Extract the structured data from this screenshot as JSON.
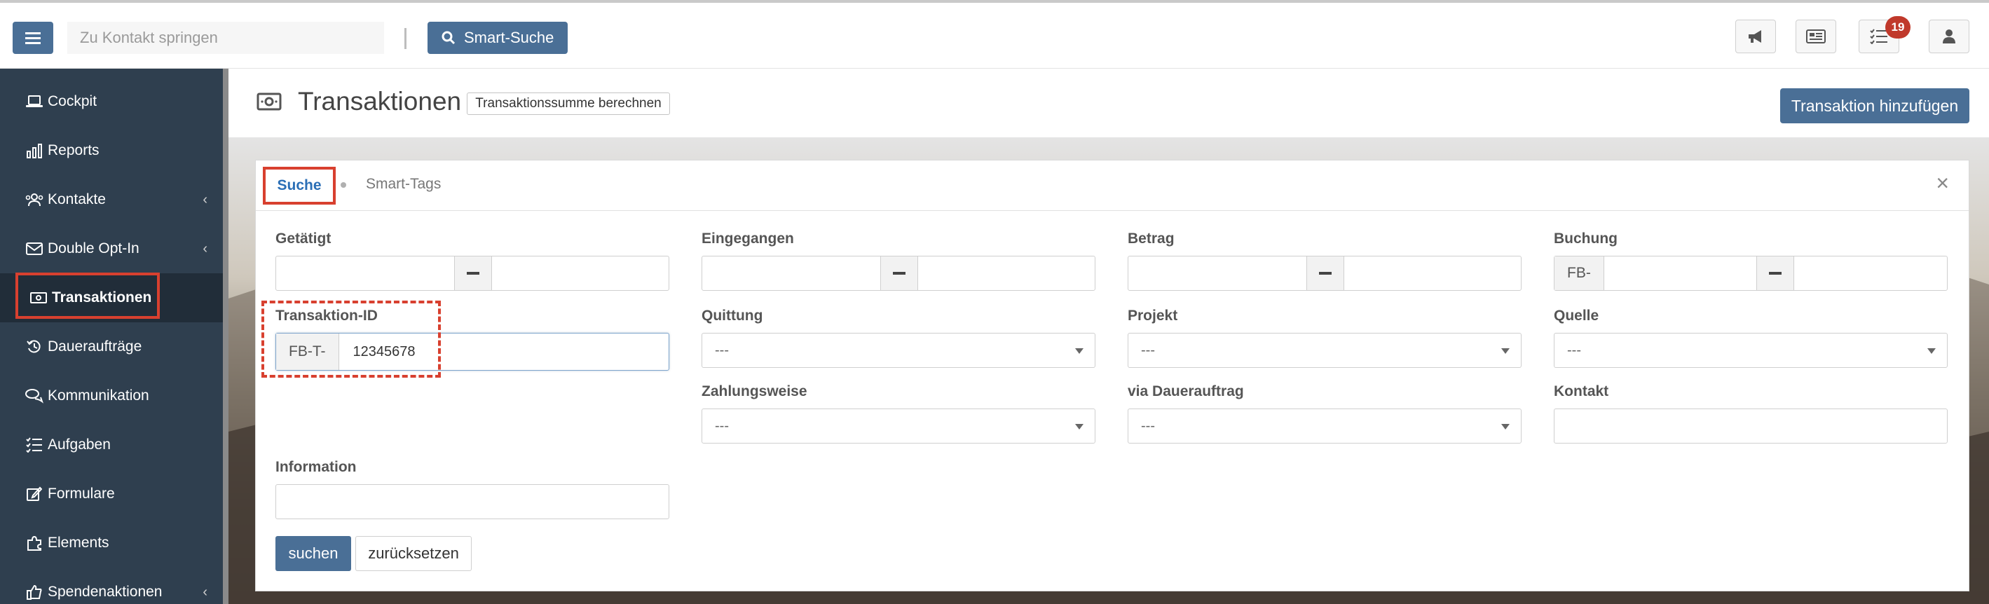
{
  "topbar": {
    "search_placeholder": "Zu Kontakt springen",
    "smart_search_label": "Smart-Suche",
    "tasks_badge": "19"
  },
  "sidebar": {
    "items": [
      {
        "label": "Cockpit",
        "icon": "laptop-icon"
      },
      {
        "label": "Reports",
        "icon": "chart-icon"
      },
      {
        "label": "Kontakte",
        "icon": "users-icon",
        "has_children": true
      },
      {
        "label": "Double Opt-In",
        "icon": "envelope-icon",
        "has_children": true
      },
      {
        "label": "Transaktionen",
        "icon": "money-icon",
        "active": true
      },
      {
        "label": "Daueraufträge",
        "icon": "history-icon"
      },
      {
        "label": "Kommunikation",
        "icon": "chat-icon"
      },
      {
        "label": "Aufgaben",
        "icon": "tasks-icon"
      },
      {
        "label": "Formulare",
        "icon": "edit-icon"
      },
      {
        "label": "Elements",
        "icon": "puzzle-icon"
      },
      {
        "label": "Spendenaktionen",
        "icon": "thumbs-up-icon",
        "has_children": true
      }
    ]
  },
  "header": {
    "title": "Transaktionen",
    "calc_button": "Transaktionssumme berechnen",
    "add_button": "Transaktion hinzufügen"
  },
  "panel": {
    "tabs": [
      {
        "label": "Suche",
        "active": true
      },
      {
        "label": "Smart-Tags",
        "active": false
      }
    ],
    "close": "×",
    "fields": {
      "getaetigt": "Getätigt",
      "eingegangen": "Eingegangen",
      "betrag": "Betrag",
      "buchung": "Buchung",
      "buchung_prefix": "FB-",
      "transaktion_id": "Transaktion-ID",
      "transaktion_id_prefix": "FB-T-",
      "transaktion_id_value": "12345678",
      "quittung": "Quittung",
      "quittung_value": "---",
      "projekt": "Projekt",
      "projekt_value": "---",
      "quelle": "Quelle",
      "quelle_value": "---",
      "zahlungsweise": "Zahlungsweise",
      "zahlungsweise_value": "---",
      "via_dauerauftrag": "via Dauerauftrag",
      "via_dauerauftrag_value": "---",
      "kontakt": "Kontakt",
      "information": "Information"
    },
    "search_button": "suchen",
    "reset_button": "zurücksetzen"
  },
  "colors": {
    "primary": "#4a6f96",
    "sidebar": "#2f3f4f",
    "highlight": "#d8402f",
    "active_tab": "#2b6fb6"
  }
}
